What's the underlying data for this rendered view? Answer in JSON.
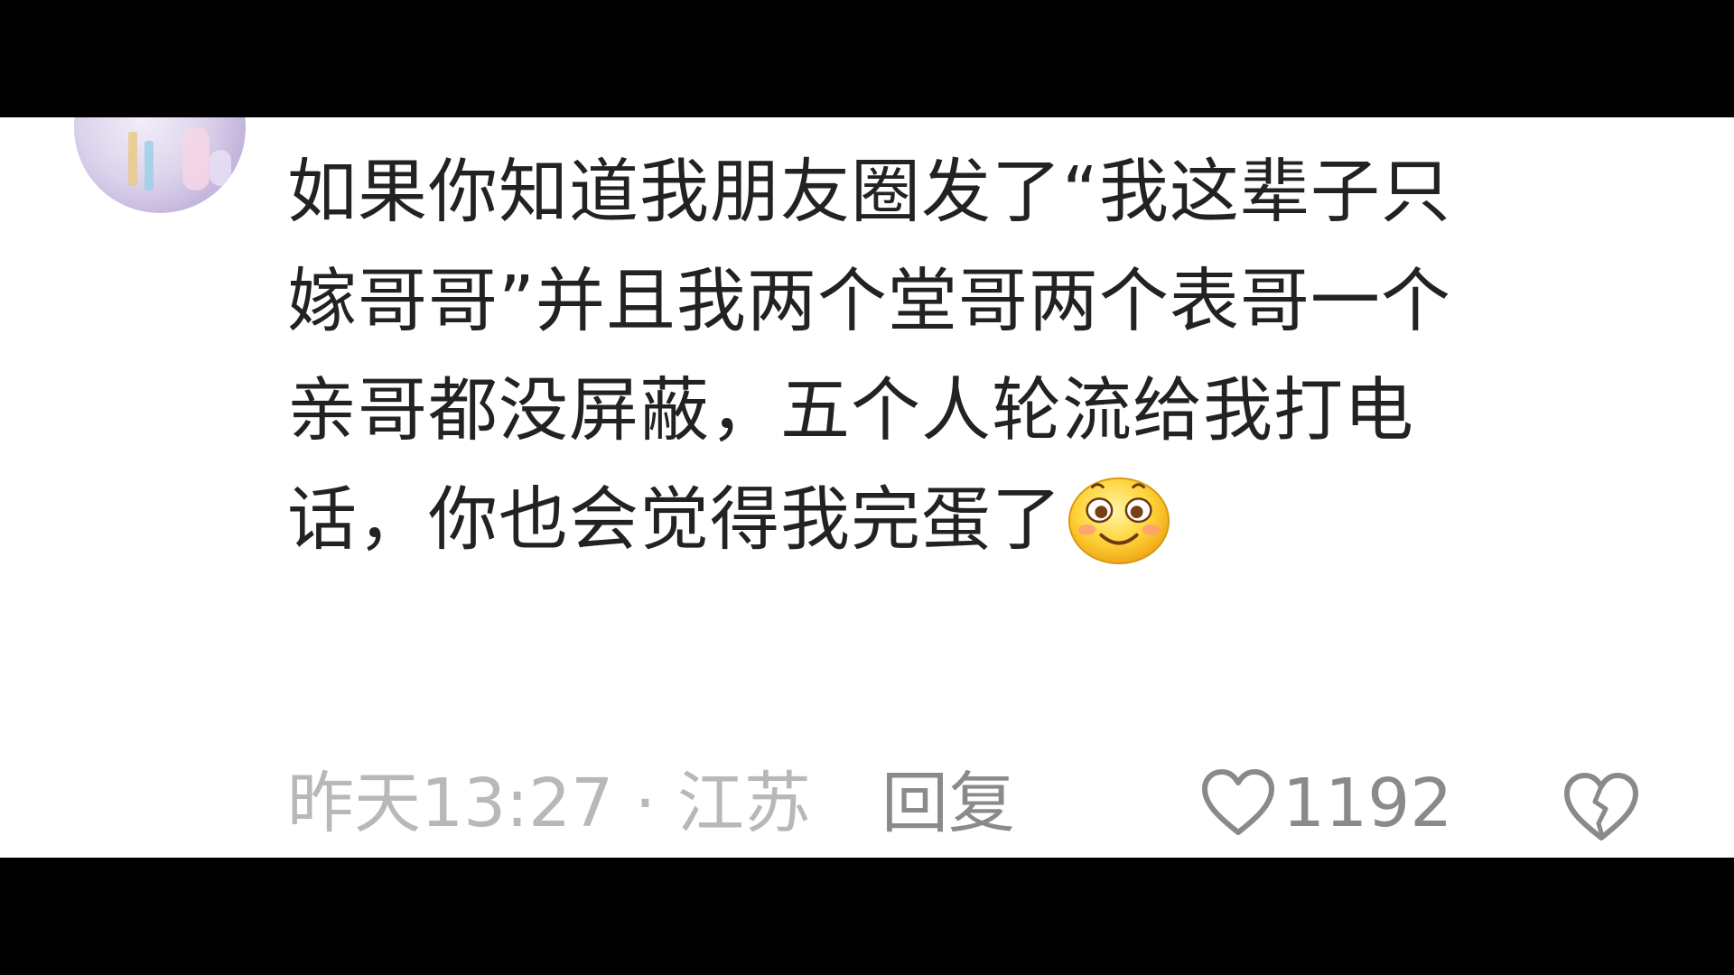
{
  "comment": {
    "text_lines": [
      "如果你知道我朋友圈发了“我这辈子只",
      "嫁哥哥”并且我两个堂哥两个表哥一个",
      "亲哥都没屏蔽，五个人轮流给我打电",
      "话，你也会觉得我完蛋了"
    ],
    "emoji": "blushing-smile-emoji"
  },
  "meta": {
    "time_location": "昨天13:27 · 江苏",
    "reply_label": "回复",
    "like_count": "1192"
  },
  "icons": {
    "like": "heart-outline-icon",
    "dislike": "broken-heart-icon"
  },
  "colors": {
    "text": "#222222",
    "meta_light": "#b8b8b8",
    "meta": "#8a8a8a",
    "background": "#ffffff",
    "letterbox": "#000000"
  }
}
